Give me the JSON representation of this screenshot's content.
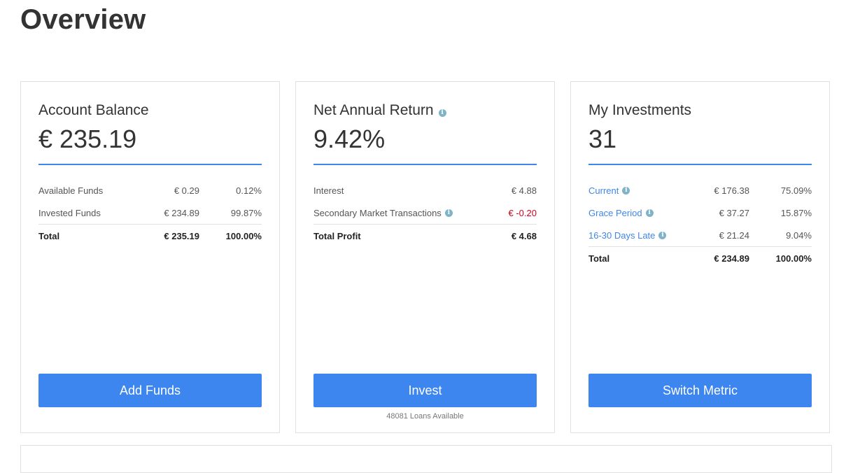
{
  "page": {
    "title": "Overview"
  },
  "cards": [
    {
      "title": "Account Balance",
      "value": "€ 235.19",
      "rows": [
        {
          "label": "Available Funds",
          "amount": "€ 0.29",
          "percent": "0.12%"
        },
        {
          "label": "Invested Funds",
          "amount": "€ 234.89",
          "percent": "99.87%"
        }
      ],
      "total": {
        "label": "Total",
        "amount": "€ 235.19",
        "percent": "100.00%"
      },
      "button_label": "Add Funds"
    },
    {
      "title": "Net Annual Return",
      "title_info_icon": "info-icon",
      "value": "9.42%",
      "rows": [
        {
          "label": "Interest",
          "amount": "€ 4.88"
        },
        {
          "label": "Secondary Market Transactions",
          "amount": "€ -0.20",
          "info_icon": "info-icon",
          "amount_color": "#d0021b"
        }
      ],
      "total": {
        "label": "Total Profit",
        "amount": "€ 4.68"
      },
      "button_label": "Invest",
      "note": "48081 Loans Available"
    },
    {
      "title": "My Investments",
      "value": "31",
      "rows": [
        {
          "label": "Current",
          "amount": "€ 176.38",
          "percent": "75.09%",
          "info_icon": "info-icon"
        },
        {
          "label": "Grace Period",
          "amount": "€ 37.27",
          "percent": "15.87%",
          "info_icon": "info-icon"
        },
        {
          "label": "16-30 Days Late",
          "amount": "€ 21.24",
          "percent": "9.04%",
          "info_icon": "info-icon"
        }
      ],
      "total": {
        "label": "Total",
        "amount": "€ 234.89",
        "percent": "100.00%"
      },
      "button_label": "Switch Metric"
    }
  ],
  "colors": {
    "accent": "#3d86ef",
    "rule": "#3f86e8",
    "negative": "#d0021b",
    "info_icon": "#7fb3c9",
    "link": "#3f86e8"
  }
}
